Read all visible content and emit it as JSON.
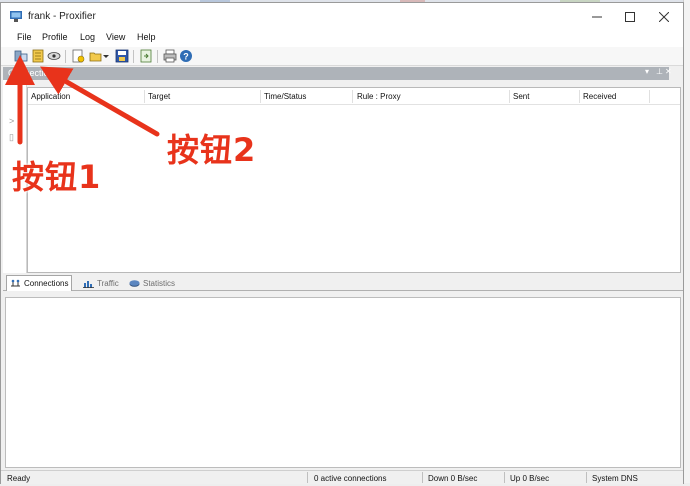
{
  "window": {
    "title": "frank - Proxifier"
  },
  "menu": {
    "items": [
      "File",
      "Profile",
      "Log",
      "View",
      "Help"
    ]
  },
  "toolbar": {
    "buttons": [
      {
        "icon": "proxy-servers-icon"
      },
      {
        "icon": "proxification-rules-icon"
      },
      {
        "icon": "name-resolution-icon"
      },
      {
        "icon": "new-profile-icon"
      },
      {
        "icon": "open-profile-icon"
      },
      {
        "icon": "save-profile-icon"
      },
      {
        "icon": "export-icon"
      },
      {
        "icon": "print-icon"
      },
      {
        "icon": "help-icon"
      }
    ]
  },
  "connections_panel": {
    "title": "Connections",
    "columns": [
      "Application",
      "Target",
      "Time/Status",
      "Rule : Proxy",
      "Sent",
      "Received"
    ],
    "rows": []
  },
  "tabs": [
    {
      "label": "Connections",
      "icon": "connections-icon",
      "active": true
    },
    {
      "label": "Traffic",
      "icon": "traffic-chart-icon",
      "active": false
    },
    {
      "label": "Statistics",
      "icon": "statistics-icon",
      "active": false
    }
  ],
  "status": {
    "ready": "Ready",
    "connections": "0 active connections",
    "down": "Down 0 B/sec",
    "up": "Up 0 B/sec",
    "dns": "System DNS"
  },
  "annotations": {
    "button1": "按钮1",
    "button2": "按钮2"
  },
  "colors": {
    "annotation_red": "#e8331b",
    "panel_header": "#aeb3b9",
    "window_bg": "#f0f0f0"
  }
}
